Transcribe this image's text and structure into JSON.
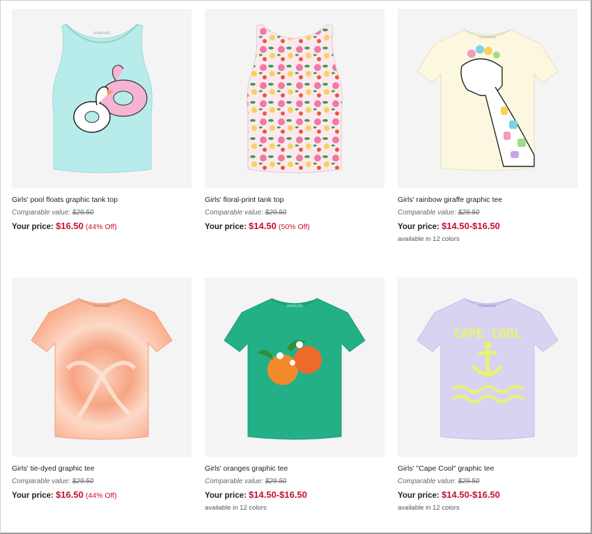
{
  "products": [
    {
      "name": "Girls' pool floats graphic tank top",
      "comparable_label": "Comparable value:",
      "comparable_price": "$29.50",
      "price_label": "Your price:",
      "price": "$16.50",
      "discount": "(44% Off)",
      "colors": "",
      "image_icon": "tank-top-pool-floats",
      "image_color": "#b7ecea"
    },
    {
      "name": "Girls' floral-print tank top",
      "comparable_label": "Comparable value:",
      "comparable_price": "$29.50",
      "price_label": "Your price:",
      "price": "$14.50",
      "discount": "(50% Off)",
      "colors": "",
      "image_icon": "tank-top-floral",
      "image_color": "#fbe9ef"
    },
    {
      "name": "Girls' rainbow giraffe graphic tee",
      "comparable_label": "Comparable value:",
      "comparable_price": "$29.50",
      "price_label": "Your price:",
      "price": "$14.50-$16.50",
      "discount": "",
      "colors": "available in 12 colors",
      "image_icon": "tee-giraffe",
      "image_color": "#fbf8df"
    },
    {
      "name": "Girls' tie-dyed graphic tee",
      "comparable_label": "Comparable value:",
      "comparable_price": "$29.50",
      "price_label": "Your price:",
      "price": "$16.50",
      "discount": "(44% Off)",
      "colors": "",
      "image_icon": "tee-tie-dye",
      "image_color": "#f9b596"
    },
    {
      "name": "Girls' oranges graphic tee",
      "comparable_label": "Comparable value:",
      "comparable_price": "$29.50",
      "price_label": "Your price:",
      "price": "$14.50-$16.50",
      "discount": "",
      "colors": "available in 12 colors",
      "image_icon": "tee-oranges",
      "image_color": "#23b087"
    },
    {
      "name": "Girls' \"Cape Cool\" graphic tee",
      "comparable_label": "Comparable value:",
      "comparable_price": "$29.50",
      "price_label": "Your price:",
      "price": "$14.50-$16.50",
      "discount": "",
      "colors": "available in 12 colors",
      "image_icon": "tee-cape-cool",
      "image_color": "#d9d3f2"
    }
  ],
  "brand_tag": "crewcuts",
  "cape_cool_text": "CAPE COOL"
}
